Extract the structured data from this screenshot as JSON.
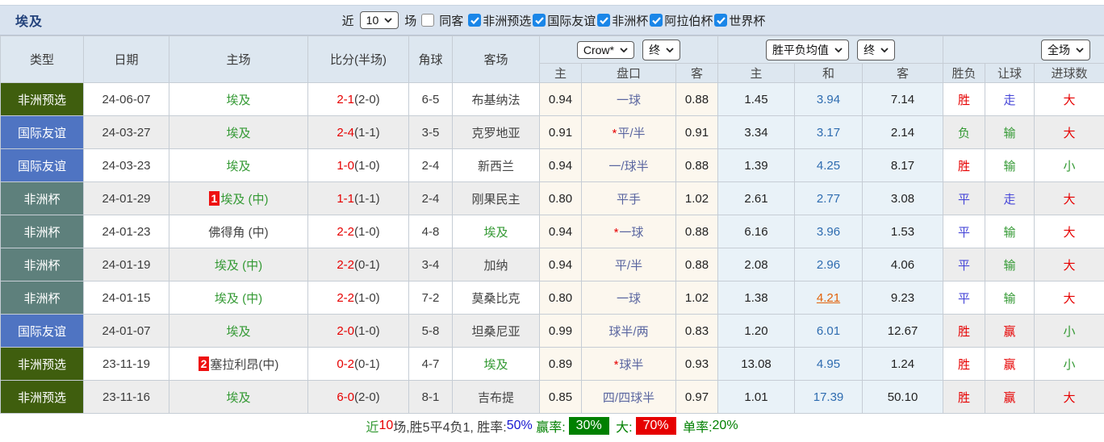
{
  "title": "埃及",
  "filters": {
    "recent_label": "近",
    "recent_value": "10",
    "games_label": "场",
    "same_away": {
      "label": "同客",
      "checked": false
    },
    "competitions": [
      {
        "label": "非洲预选",
        "checked": true
      },
      {
        "label": "国际友谊",
        "checked": true
      },
      {
        "label": "非洲杯",
        "checked": true
      },
      {
        "label": "阿拉伯杯",
        "checked": true
      },
      {
        "label": "世界杯",
        "checked": true
      }
    ]
  },
  "header": {
    "col_type": "类型",
    "col_date": "日期",
    "col_home": "主场",
    "col_score": "比分(半场)",
    "col_corner": "角球",
    "col_away": "客场",
    "bookmaker_select": "Crow*",
    "bookmaker_state_select": "终",
    "avg_select": "胜平负均值",
    "avg_state_select": "终",
    "scope_select": "全场",
    "sub_home": "主",
    "sub_handicap": "盘口",
    "sub_away": "客",
    "sub_avg_home": "主",
    "sub_avg_draw": "和",
    "sub_avg_away": "客",
    "sub_result": "胜负",
    "sub_handicap_result": "让球",
    "sub_goals": "进球数"
  },
  "rows": [
    {
      "type": "非洲预选",
      "type_key": "preliminary",
      "date": "24-06-07",
      "home": {
        "badge": "",
        "name": "埃及",
        "highlight": true
      },
      "score": "2-1",
      "half": "(2-0)",
      "corner": "6-5",
      "away": {
        "name": "布基纳法",
        "highlight": false
      },
      "odds_home": "0.94",
      "handicap": "一球",
      "handicap_star": false,
      "odds_away": "0.88",
      "avg_home": "1.45",
      "avg_draw": "3.94",
      "avg_away": "7.14",
      "avg_draw_highlight": false,
      "result": {
        "text": "胜",
        "color": "red"
      },
      "handicap_result": {
        "text": "走",
        "color": "blue"
      },
      "goals": {
        "text": "大",
        "color": "red"
      }
    },
    {
      "type": "国际友谊",
      "type_key": "friendly",
      "date": "24-03-27",
      "home": {
        "badge": "",
        "name": "埃及",
        "highlight": true
      },
      "score": "2-4",
      "half": "(1-1)",
      "corner": "3-5",
      "away": {
        "name": "克罗地亚",
        "highlight": false
      },
      "odds_home": "0.91",
      "handicap": "平/半",
      "handicap_star": true,
      "odds_away": "0.91",
      "avg_home": "3.34",
      "avg_draw": "3.17",
      "avg_away": "2.14",
      "avg_draw_highlight": false,
      "result": {
        "text": "负",
        "color": "green"
      },
      "handicap_result": {
        "text": "输",
        "color": "green"
      },
      "goals": {
        "text": "大",
        "color": "red"
      }
    },
    {
      "type": "国际友谊",
      "type_key": "friendly",
      "date": "24-03-23",
      "home": {
        "badge": "",
        "name": "埃及",
        "highlight": true
      },
      "score": "1-0",
      "half": "(1-0)",
      "corner": "2-4",
      "away": {
        "name": "新西兰",
        "highlight": false
      },
      "odds_home": "0.94",
      "handicap": "一/球半",
      "handicap_star": false,
      "odds_away": "0.88",
      "avg_home": "1.39",
      "avg_draw": "4.25",
      "avg_away": "8.17",
      "avg_draw_highlight": false,
      "result": {
        "text": "胜",
        "color": "red"
      },
      "handicap_result": {
        "text": "输",
        "color": "green"
      },
      "goals": {
        "text": "小",
        "color": "green"
      }
    },
    {
      "type": "非洲杯",
      "type_key": "cup",
      "date": "24-01-29",
      "home": {
        "badge": "1",
        "name": "埃及 (中)",
        "highlight": true
      },
      "score": "1-1",
      "half": "(1-1)",
      "corner": "2-4",
      "away": {
        "name": "刚果民主",
        "highlight": false
      },
      "odds_home": "0.80",
      "handicap": "平手",
      "handicap_star": false,
      "odds_away": "1.02",
      "avg_home": "2.61",
      "avg_draw": "2.77",
      "avg_away": "3.08",
      "avg_draw_highlight": false,
      "result": {
        "text": "平",
        "color": "blue"
      },
      "handicap_result": {
        "text": "走",
        "color": "blue"
      },
      "goals": {
        "text": "大",
        "color": "red"
      }
    },
    {
      "type": "非洲杯",
      "type_key": "cup",
      "date": "24-01-23",
      "home": {
        "badge": "",
        "name": "佛得角 (中)",
        "highlight": false
      },
      "score": "2-2",
      "half": "(1-0)",
      "corner": "4-8",
      "away": {
        "name": "埃及",
        "highlight": true
      },
      "odds_home": "0.94",
      "handicap": "一球",
      "handicap_star": true,
      "odds_away": "0.88",
      "avg_home": "6.16",
      "avg_draw": "3.96",
      "avg_away": "1.53",
      "avg_draw_highlight": false,
      "result": {
        "text": "平",
        "color": "blue"
      },
      "handicap_result": {
        "text": "输",
        "color": "green"
      },
      "goals": {
        "text": "大",
        "color": "red"
      }
    },
    {
      "type": "非洲杯",
      "type_key": "cup",
      "date": "24-01-19",
      "home": {
        "badge": "",
        "name": "埃及 (中)",
        "highlight": true
      },
      "score": "2-2",
      "half": "(0-1)",
      "corner": "3-4",
      "away": {
        "name": "加纳",
        "highlight": false
      },
      "odds_home": "0.94",
      "handicap": "平/半",
      "handicap_star": false,
      "odds_away": "0.88",
      "avg_home": "2.08",
      "avg_draw": "2.96",
      "avg_away": "4.06",
      "avg_draw_highlight": false,
      "result": {
        "text": "平",
        "color": "blue"
      },
      "handicap_result": {
        "text": "输",
        "color": "green"
      },
      "goals": {
        "text": "大",
        "color": "red"
      }
    },
    {
      "type": "非洲杯",
      "type_key": "cup",
      "date": "24-01-15",
      "home": {
        "badge": "",
        "name": "埃及 (中)",
        "highlight": true
      },
      "score": "2-2",
      "half": "(1-0)",
      "corner": "7-2",
      "away": {
        "name": "莫桑比克",
        "highlight": false
      },
      "odds_home": "0.80",
      "handicap": "一球",
      "handicap_star": false,
      "odds_away": "1.02",
      "avg_home": "1.38",
      "avg_draw": "4.21",
      "avg_away": "9.23",
      "avg_draw_highlight": true,
      "result": {
        "text": "平",
        "color": "blue"
      },
      "handicap_result": {
        "text": "输",
        "color": "green"
      },
      "goals": {
        "text": "大",
        "color": "red"
      }
    },
    {
      "type": "国际友谊",
      "type_key": "friendly",
      "date": "24-01-07",
      "home": {
        "badge": "",
        "name": "埃及",
        "highlight": true
      },
      "score": "2-0",
      "half": "(1-0)",
      "corner": "5-8",
      "away": {
        "name": "坦桑尼亚",
        "highlight": false
      },
      "odds_home": "0.99",
      "handicap": "球半/两",
      "handicap_star": false,
      "odds_away": "0.83",
      "avg_home": "1.20",
      "avg_draw": "6.01",
      "avg_away": "12.67",
      "avg_draw_highlight": false,
      "result": {
        "text": "胜",
        "color": "red"
      },
      "handicap_result": {
        "text": "赢",
        "color": "red"
      },
      "goals": {
        "text": "小",
        "color": "green"
      }
    },
    {
      "type": "非洲预选",
      "type_key": "preliminary",
      "date": "23-11-19",
      "home": {
        "badge": "2",
        "name": "塞拉利昂(中)",
        "highlight": false
      },
      "score": "0-2",
      "half": "(0-1)",
      "corner": "4-7",
      "away": {
        "name": "埃及",
        "highlight": true
      },
      "odds_home": "0.89",
      "handicap": "球半",
      "handicap_star": true,
      "odds_away": "0.93",
      "avg_home": "13.08",
      "avg_draw": "4.95",
      "avg_away": "1.24",
      "avg_draw_highlight": false,
      "result": {
        "text": "胜",
        "color": "red"
      },
      "handicap_result": {
        "text": "赢",
        "color": "red"
      },
      "goals": {
        "text": "小",
        "color": "green"
      }
    },
    {
      "type": "非洲预选",
      "type_key": "preliminary",
      "date": "23-11-16",
      "home": {
        "badge": "",
        "name": "埃及",
        "highlight": true
      },
      "score": "6-0",
      "half": "(2-0)",
      "corner": "8-1",
      "away": {
        "name": "吉布提",
        "highlight": false
      },
      "odds_home": "0.85",
      "handicap": "四/四球半",
      "handicap_star": false,
      "odds_away": "0.97",
      "avg_home": "1.01",
      "avg_draw": "17.39",
      "avg_away": "50.10",
      "avg_draw_highlight": false,
      "result": {
        "text": "胜",
        "color": "red"
      },
      "handicap_result": {
        "text": "赢",
        "color": "red"
      },
      "goals": {
        "text": "大",
        "color": "red"
      }
    }
  ],
  "summary": {
    "segments": [
      {
        "text": "近",
        "color": "green"
      },
      {
        "text": "10",
        "color": "red"
      },
      {
        "text": "场,胜5平4负1, 胜率:",
        "color": "dark"
      },
      {
        "text": "50%",
        "color": "summary_blue"
      },
      {
        "text": " 赢率:",
        "color": "summary_green"
      },
      {
        "text": "30%",
        "color": "white",
        "bg": "summary_green_bg"
      },
      {
        "text": " 大:",
        "color": "summary_green"
      },
      {
        "text": "70%",
        "color": "white",
        "bg": "summary_red_bg"
      },
      {
        "text": " 单率:",
        "color": "summary_green"
      },
      {
        "text": "20%",
        "color": "summary_green"
      }
    ]
  },
  "colors": {
    "red": "#e60000",
    "green": "#339933",
    "blue": "#4646d8",
    "dark": "#3c3c3c",
    "team_green": "#339933",
    "team_plain": "#444444",
    "handicap_text": "#5a66a0",
    "avg_draw_blue": "#2e6cb0",
    "avg_draw_orange": "#e2620a",
    "type_preliminary": "#3f5e0e",
    "type_friendly": "#4f74c2",
    "type_cup": "#5e807c",
    "badge_red": "#ee1111",
    "white": "#ffffff",
    "summary_blue": "#1515d0",
    "summary_green": "#008000",
    "summary_green_bg": "#008000",
    "summary_red_bg": "#e60000",
    "checkbox_blue": "#1a86e8"
  }
}
